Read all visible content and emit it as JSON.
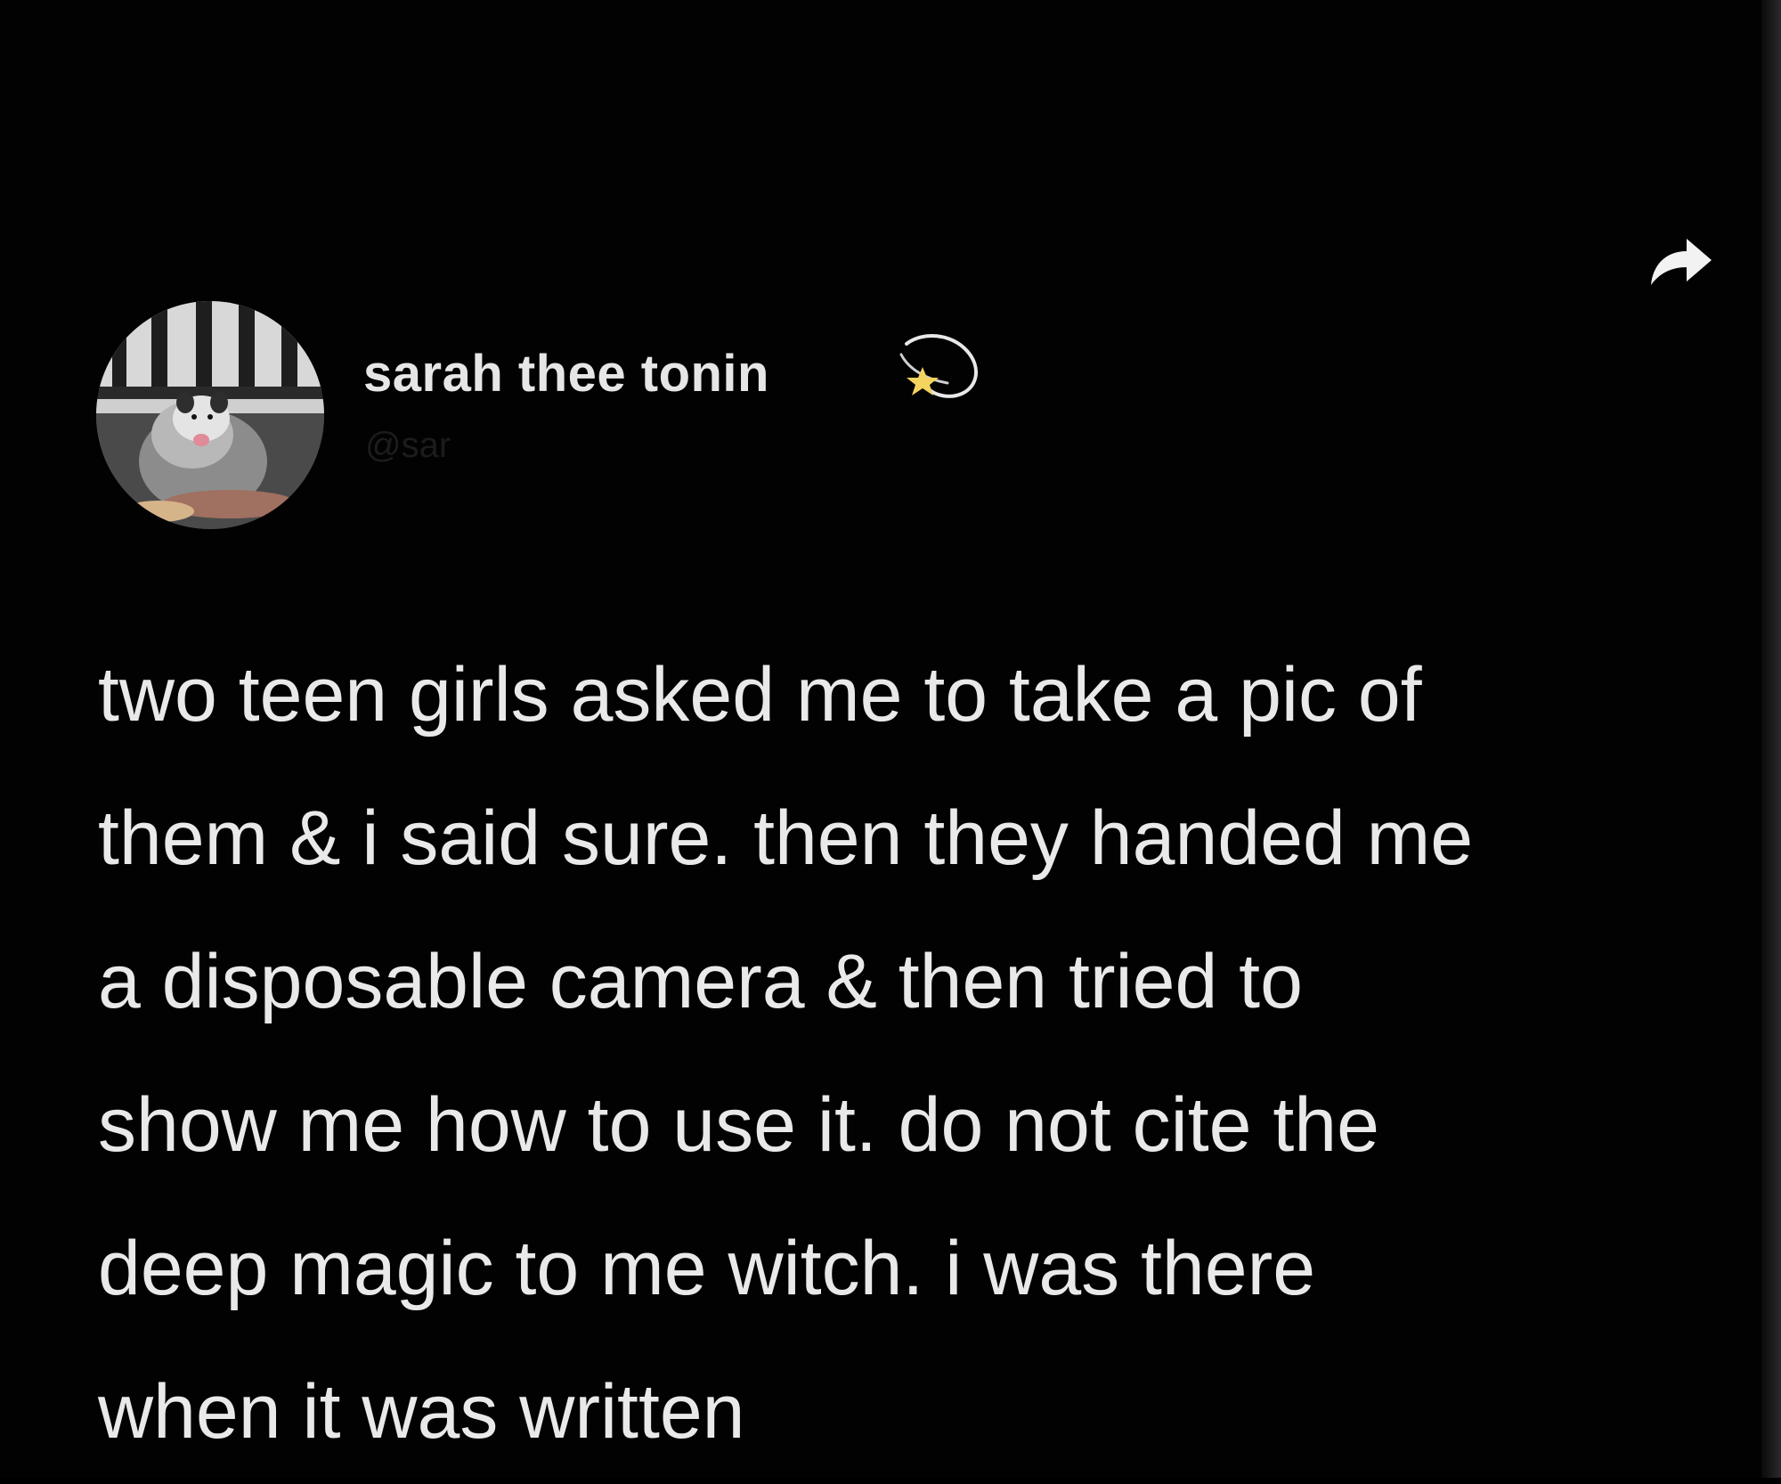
{
  "tweet": {
    "author": {
      "display_name": "sarah thee tonin",
      "name_emoji_icon": "dizzy-star-icon",
      "handle": "@sar",
      "avatar_icon": "opossum-avatar"
    },
    "share_icon": "share-arrow-icon",
    "body_lines": [
      "two teen girls asked me to take a pic of",
      "them & i said sure. then they handed me",
      "a disposable camera & then tried to",
      "show me how to use it. do not cite the",
      "deep magic to me witch. i was there",
      "when it was written"
    ]
  },
  "colors": {
    "background": "#020202",
    "text": "#e9e9e9",
    "handle_text": "#1c1c1c"
  }
}
